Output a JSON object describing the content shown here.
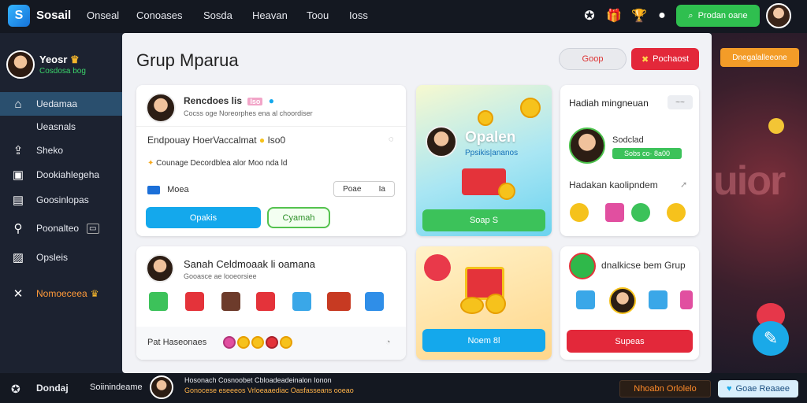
{
  "topbar": {
    "app_title": "Sosail",
    "nav": [
      "Onseal",
      "Conoases",
      "Sosda",
      "Heavan",
      "Toou",
      "Ioss"
    ],
    "cta_label": "Prodan oane"
  },
  "sidebar": {
    "profile_name": "Yeosr",
    "profile_sub": "Cosdosa bog",
    "items": [
      {
        "label": "Uedamaa",
        "icon": "home-icon"
      },
      {
        "label": "Ueasnals",
        "icon": ""
      },
      {
        "label": "Sheko",
        "icon": "share-icon"
      },
      {
        "label": "Dookiahlegeha",
        "icon": "calendar-icon"
      },
      {
        "label": "Goosinlopas",
        "icon": "chart-icon"
      },
      {
        "label": "Poonalteo",
        "icon": "location-icon"
      },
      {
        "label": "Opsleis",
        "icon": "image-icon"
      },
      {
        "label": "Nomoeceea",
        "icon": "person-icon"
      }
    ]
  },
  "main": {
    "title": "Grup Mparua",
    "btn_grup": "Goop",
    "btn_red": "Pochaost",
    "card1": {
      "name": "Rencdoes lis",
      "tag": "Iso",
      "sub": "Cocss oge Noreorphes ena al choordiser",
      "line1": "Endpouay HoerVaccalmat",
      "line1_extra": "Iso0",
      "line2": "Counage Decordblea alor Moo nda ld",
      "row_label": "Moea",
      "field_value": "Poae",
      "field_suffix": "Ia",
      "btn1": "Opakis",
      "btn2": "Cyamah"
    },
    "card2": {
      "title": "Opalen",
      "sub": "Ppsikis|ananos",
      "btn": "Soap S"
    },
    "card3": {
      "title": "Hadiah mingneuan",
      "pill": "~~",
      "name": "Sodclad",
      "badge": "Sobs co· 8a00",
      "line": "Hadakan kaolipndem"
    },
    "card4": {
      "title": "Sanah Celdmoaak li oamana",
      "sub": "Gooasce ae looeorsiee",
      "footer": "Pat Haseonaes"
    },
    "card5": {
      "btn": "Noem 8l"
    },
    "card6": {
      "title": "dnalkicse bem Grup",
      "btn": "Supeas"
    }
  },
  "background": {
    "pill": "Dnegalalleeone",
    "word": "uior"
  },
  "bottombar": {
    "left_label": "Dondaj",
    "center_label": "Soiinindeame",
    "ticker1": "Hosonach Cosnoobet Cbloadeadeinalon Ionon",
    "ticker2": "Gonocese eseeeos Vrloeaaediac Oasfasseans ooeao",
    "orange_label": "Nhoabn Orlolelo",
    "blue_label": "Goae Reaaee"
  }
}
